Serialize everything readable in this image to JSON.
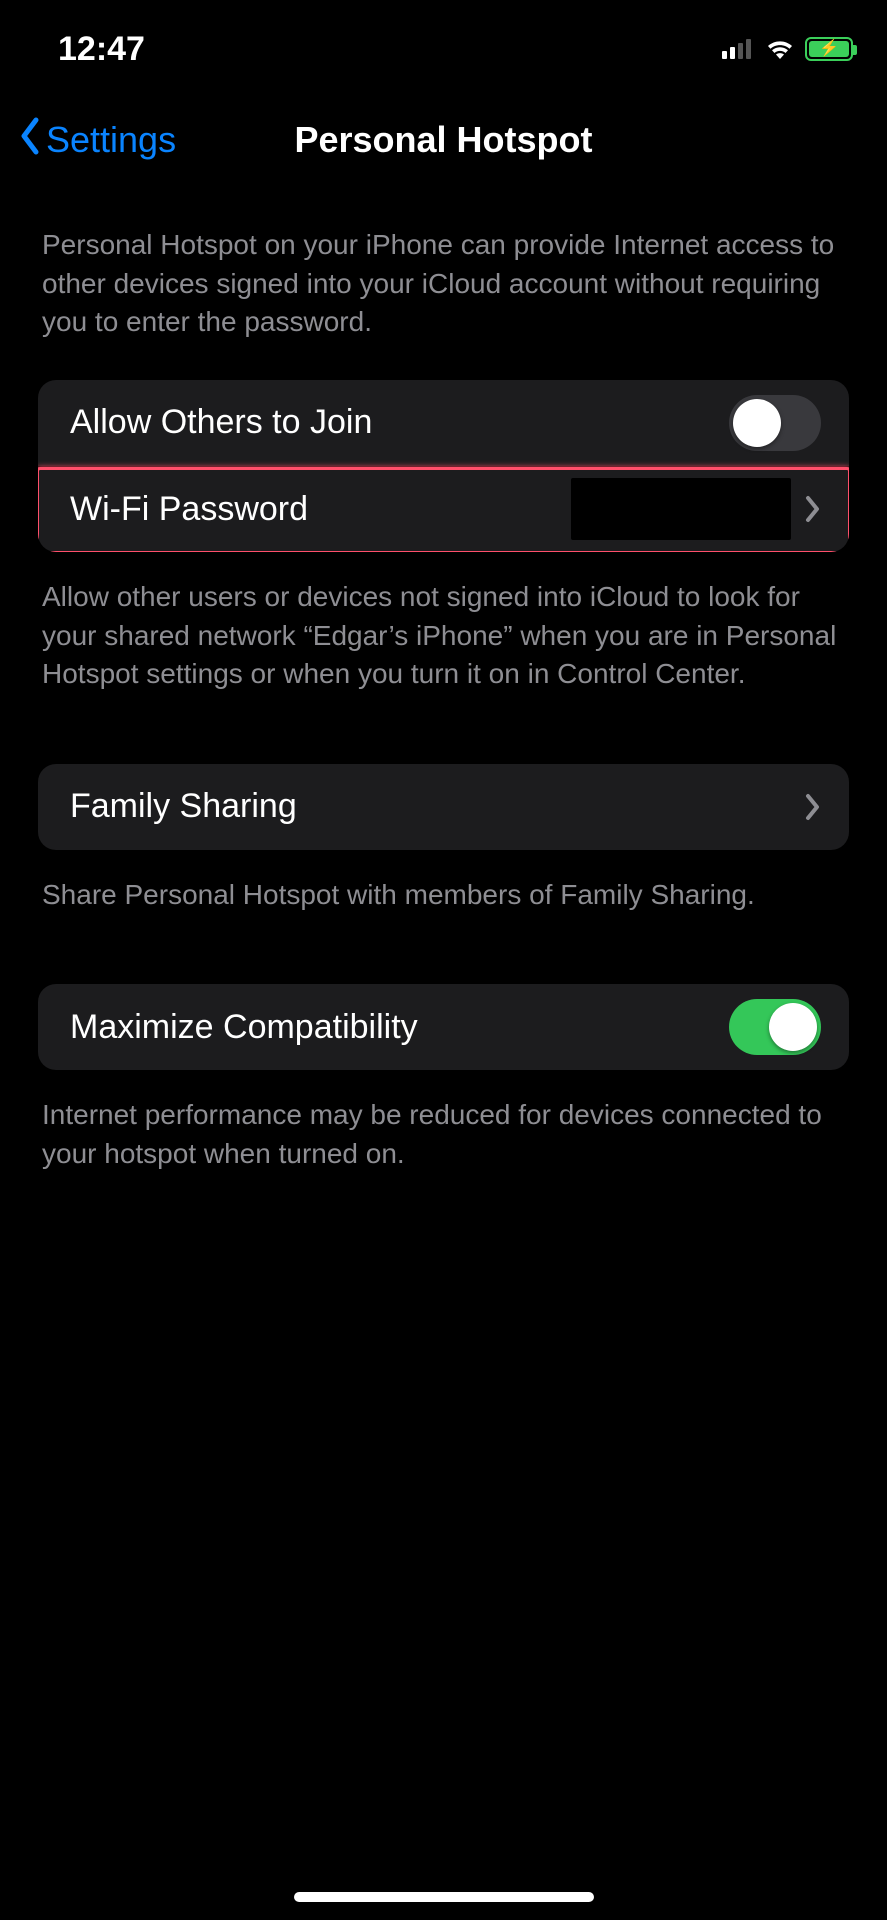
{
  "status": {
    "time": "12:47"
  },
  "nav": {
    "back_label": "Settings",
    "title": "Personal Hotspot"
  },
  "description_top": "Personal Hotspot on your iPhone can provide Internet access to other devices signed into your iCloud account without requiring you to enter the password.",
  "rows": {
    "allow_join": {
      "label": "Allow Others to Join",
      "on": false
    },
    "wifi_password": {
      "label": "Wi-Fi Password"
    },
    "family_sharing": {
      "label": "Family Sharing"
    },
    "max_compat": {
      "label": "Maximize Compatibility",
      "on": true
    }
  },
  "description_allow": "Allow other users or devices not signed into iCloud to look for your shared network “Edgar’s iPhone” when you are in Personal Hotspot settings or when you turn it on in Control Center.",
  "description_family": "Share Personal Hotspot with members of Family Sharing.",
  "description_compat": "Internet performance may be reduced for devices connected to your hotspot when turned on."
}
